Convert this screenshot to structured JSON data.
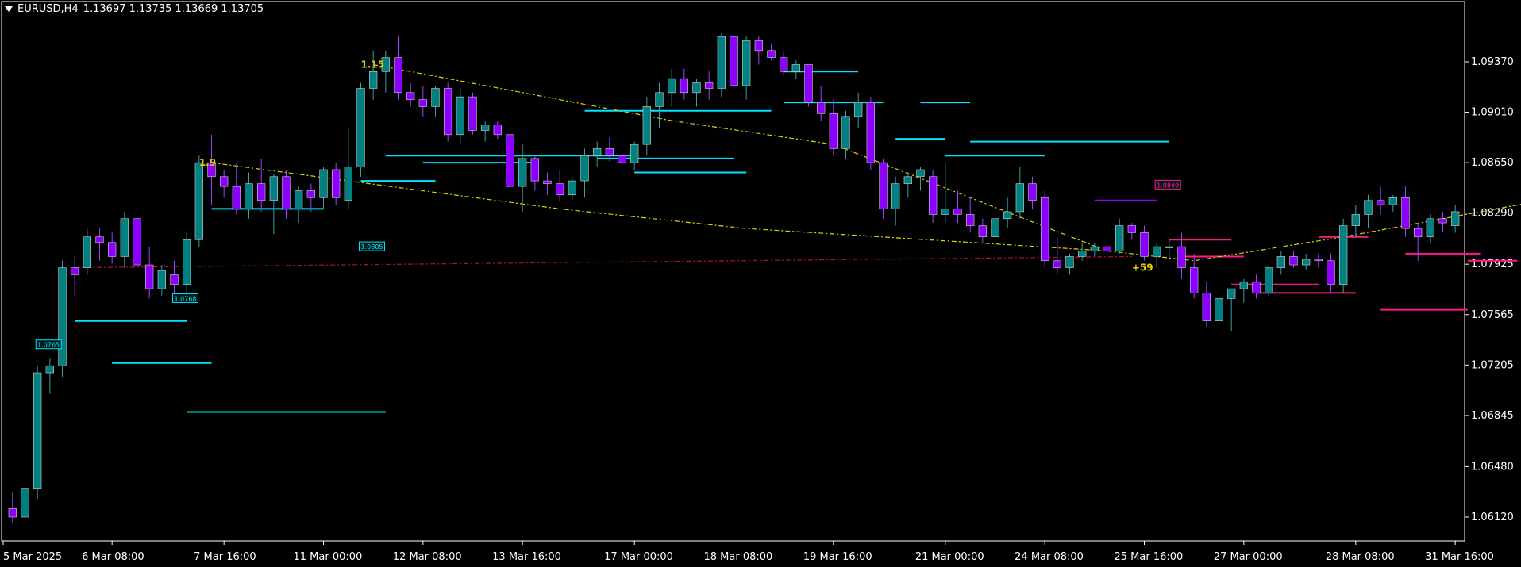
{
  "header": {
    "symbol": "EURUSD,H4",
    "ohlc": "1.13697 1.13735 1.13669 1.13705"
  },
  "colors": {
    "background": "#000000",
    "axis": "#ffffff",
    "bull": "#008080",
    "bear": "#8b00ff",
    "level_cyan": "#00e5ff",
    "level_magenta": "#ff1a8c",
    "trend_yellow": "#e0d000",
    "trend_red": "#b01030"
  },
  "chart_data": {
    "type": "candlestick",
    "ylim": [
      1.0595,
      1.098
    ],
    "y_ticks": [
      "1.09370",
      "1.09010",
      "1.08650",
      "1.08290",
      "1.07925",
      "1.07565",
      "1.07205",
      "1.06845",
      "1.06480",
      "1.06120"
    ],
    "x_ticks": [
      "5 Mar 2025",
      "6 Mar 08:00",
      "7 Mar 16:00",
      "11 Mar 00:00",
      "12 Mar 08:00",
      "13 Mar 16:00",
      "17 Mar 00:00",
      "18 Mar 08:00",
      "19 Mar 16:00",
      "21 Mar 00:00",
      "24 Mar 08:00",
      "25 Mar 16:00",
      "27 Mar 00:00",
      "28 Mar 08:00",
      "31 Mar 16:00"
    ],
    "candles": [
      [
        1.0618,
        1.063,
        1.0608,
        1.0612
      ],
      [
        1.0612,
        1.0634,
        1.0602,
        1.0632
      ],
      [
        1.0632,
        1.072,
        1.0625,
        1.0715
      ],
      [
        1.0715,
        1.0725,
        1.07,
        1.072
      ],
      [
        1.072,
        1.0795,
        1.0712,
        1.079
      ],
      [
        1.079,
        1.0798,
        1.077,
        1.0785
      ],
      [
        1.079,
        1.0818,
        1.0785,
        1.0812
      ],
      [
        1.0812,
        1.0818,
        1.0795,
        1.0808
      ],
      [
        1.0808,
        1.0815,
        1.0793,
        1.0798
      ],
      [
        1.0798,
        1.083,
        1.079,
        1.0825
      ],
      [
        1.0825,
        1.0845,
        1.0805,
        1.0792
      ],
      [
        1.0792,
        1.0805,
        1.0768,
        1.0775
      ],
      [
        1.0775,
        1.0792,
        1.077,
        1.0788
      ],
      [
        1.0785,
        1.0795,
        1.077,
        1.0778
      ],
      [
        1.0778,
        1.0815,
        1.0772,
        1.081
      ],
      [
        1.081,
        1.087,
        1.0805,
        1.0865
      ],
      [
        1.0865,
        1.0885,
        1.0835,
        1.0855
      ],
      [
        1.0855,
        1.086,
        1.084,
        1.0848
      ],
      [
        1.0848,
        1.0865,
        1.0828,
        1.0832
      ],
      [
        1.0832,
        1.0858,
        1.0825,
        1.085
      ],
      [
        1.085,
        1.0868,
        1.083,
        1.0838
      ],
      [
        1.0838,
        1.0857,
        1.0814,
        1.0855
      ],
      [
        1.0855,
        1.086,
        1.0825,
        1.0832
      ],
      [
        1.0832,
        1.0848,
        1.0822,
        1.0845
      ],
      [
        1.0845,
        1.085,
        1.083,
        1.084
      ],
      [
        1.084,
        1.0862,
        1.0832,
        1.086
      ],
      [
        1.086,
        1.0865,
        1.0835,
        1.084
      ],
      [
        1.0838,
        1.089,
        1.0832,
        1.0862
      ],
      [
        1.0862,
        1.0922,
        1.0855,
        1.0918
      ],
      [
        1.0918,
        1.0945,
        1.091,
        1.093
      ],
      [
        1.093,
        1.0945,
        1.0915,
        1.094
      ],
      [
        1.094,
        1.0955,
        1.091,
        1.0915
      ],
      [
        1.0915,
        1.0922,
        1.0905,
        1.091
      ],
      [
        1.091,
        1.092,
        1.0898,
        1.0905
      ],
      [
        1.0905,
        1.092,
        1.0898,
        1.0918
      ],
      [
        1.0918,
        1.0922,
        1.088,
        1.0885
      ],
      [
        1.0885,
        1.0918,
        1.0878,
        1.0912
      ],
      [
        1.0912,
        1.0915,
        1.0885,
        1.0888
      ],
      [
        1.0888,
        1.0895,
        1.088,
        1.0892
      ],
      [
        1.0892,
        1.0895,
        1.0882,
        1.0885
      ],
      [
        1.0885,
        1.089,
        1.084,
        1.0848
      ],
      [
        1.0848,
        1.0878,
        1.083,
        1.0868
      ],
      [
        1.0868,
        1.087,
        1.0845,
        1.0852
      ],
      [
        1.0852,
        1.0858,
        1.0842,
        1.085
      ],
      [
        1.085,
        1.086,
        1.0838,
        1.0842
      ],
      [
        1.0842,
        1.0855,
        1.0838,
        1.0852
      ],
      [
        1.0852,
        1.0875,
        1.084,
        1.087
      ],
      [
        1.087,
        1.088,
        1.0862,
        1.0875
      ],
      [
        1.0875,
        1.0883,
        1.0866,
        1.087
      ],
      [
        1.087,
        1.088,
        1.0862,
        1.0865
      ],
      [
        1.0865,
        1.088,
        1.086,
        1.0878
      ],
      [
        1.0878,
        1.0912,
        1.087,
        1.0905
      ],
      [
        1.0905,
        1.0922,
        1.089,
        1.0915
      ],
      [
        1.0915,
        1.0932,
        1.0905,
        1.0925
      ],
      [
        1.0925,
        1.0932,
        1.091,
        1.0915
      ],
      [
        1.0915,
        1.0925,
        1.0905,
        1.0922
      ],
      [
        1.0922,
        1.093,
        1.091,
        1.0918
      ],
      [
        1.0918,
        1.0958,
        1.0912,
        1.0955
      ],
      [
        1.0955,
        1.0958,
        1.0915,
        1.092
      ],
      [
        1.092,
        1.0955,
        1.091,
        1.0952
      ],
      [
        1.0952,
        1.0955,
        1.0935,
        1.0945
      ],
      [
        1.0945,
        1.095,
        1.0938,
        1.094
      ],
      [
        1.094,
        1.0945,
        1.0928,
        1.093
      ],
      [
        1.093,
        1.0938,
        1.0925,
        1.0935
      ],
      [
        1.0935,
        1.0935,
        1.0905,
        1.0908
      ],
      [
        1.0908,
        1.092,
        1.0895,
        1.09
      ],
      [
        1.09,
        1.091,
        1.087,
        1.0875
      ],
      [
        1.0875,
        1.0902,
        1.0868,
        1.0898
      ],
      [
        1.0898,
        1.0915,
        1.089,
        1.0908
      ],
      [
        1.0908,
        1.0912,
        1.086,
        1.0865
      ],
      [
        1.0865,
        1.0868,
        1.0825,
        1.0832
      ],
      [
        1.0832,
        1.0855,
        1.082,
        1.085
      ],
      [
        1.085,
        1.0858,
        1.084,
        1.0855
      ],
      [
        1.0855,
        1.0862,
        1.0845,
        1.086
      ],
      [
        1.0855,
        1.086,
        1.0822,
        1.0828
      ],
      [
        1.0828,
        1.0865,
        1.0822,
        1.0832
      ],
      [
        1.0832,
        1.0845,
        1.0822,
        1.0828
      ],
      [
        1.0828,
        1.084,
        1.0815,
        1.082
      ],
      [
        1.082,
        1.0825,
        1.0808,
        1.0812
      ],
      [
        1.0812,
        1.0848,
        1.0808,
        1.0825
      ],
      [
        1.0825,
        1.084,
        1.0818,
        1.083
      ],
      [
        1.083,
        1.0862,
        1.0825,
        1.085
      ],
      [
        1.085,
        1.0855,
        1.0832,
        1.0838
      ],
      [
        1.084,
        1.0845,
        1.079,
        1.0795
      ],
      [
        1.0795,
        1.0812,
        1.0785,
        1.079
      ],
      [
        1.079,
        1.08,
        1.0785,
        1.0798
      ],
      [
        1.0798,
        1.0808,
        1.0795,
        1.0802
      ],
      [
        1.0802,
        1.0808,
        1.0798,
        1.0805
      ],
      [
        1.0805,
        1.0808,
        1.0785,
        1.0802
      ],
      [
        1.0802,
        1.0825,
        1.08,
        1.082
      ],
      [
        1.082,
        1.0822,
        1.081,
        1.0815
      ],
      [
        1.0815,
        1.082,
        1.0795,
        1.0798
      ],
      [
        1.0798,
        1.0808,
        1.079,
        1.0805
      ],
      [
        1.0805,
        1.081,
        1.0795,
        1.0805
      ],
      [
        1.0805,
        1.0815,
        1.0782,
        1.079
      ],
      [
        1.079,
        1.08,
        1.0768,
        1.0772
      ],
      [
        1.0772,
        1.078,
        1.0748,
        1.0752
      ],
      [
        1.0752,
        1.0772,
        1.0748,
        1.0768
      ],
      [
        1.0768,
        1.0772,
        1.0745,
        1.0775
      ],
      [
        1.0775,
        1.0782,
        1.0765,
        1.078
      ],
      [
        1.078,
        1.0785,
        1.0768,
        1.0772
      ],
      [
        1.0772,
        1.0792,
        1.077,
        1.079
      ],
      [
        1.079,
        1.0802,
        1.0785,
        1.0798
      ],
      [
        1.0798,
        1.0802,
        1.079,
        1.0792
      ],
      [
        1.0792,
        1.08,
        1.0788,
        1.0796
      ],
      [
        1.0796,
        1.08,
        1.079,
        1.0795
      ],
      [
        1.0795,
        1.08,
        1.0772,
        1.0778
      ],
      [
        1.0778,
        1.0825,
        1.0772,
        1.082
      ],
      [
        1.082,
        1.0835,
        1.0812,
        1.0828
      ],
      [
        1.0828,
        1.0842,
        1.0818,
        1.0838
      ],
      [
        1.0838,
        1.0848,
        1.0828,
        1.0835
      ],
      [
        1.0835,
        1.0842,
        1.083,
        1.084
      ],
      [
        1.084,
        1.0848,
        1.0812,
        1.0818
      ],
      [
        1.0818,
        1.0822,
        1.0795,
        1.0812
      ],
      [
        1.0812,
        1.0828,
        1.0808,
        1.0825
      ],
      [
        1.0825,
        1.083,
        1.0815,
        1.0822
      ],
      [
        1.082,
        1.0835,
        1.0815,
        1.083
      ]
    ],
    "trend_lines": [
      {
        "color": "yellow",
        "points": [
          [
            29,
            1.0935
          ],
          [
            53,
            1.0895
          ],
          [
            66,
            1.0878
          ],
          [
            88,
            1.0802
          ]
        ]
      },
      {
        "color": "yellow",
        "points": [
          [
            16,
            1.0865
          ],
          [
            27,
            1.0852
          ],
          [
            44,
            1.0832
          ],
          [
            59,
            1.0818
          ],
          [
            88,
            1.0802
          ]
        ]
      },
      {
        "color": "yellow",
        "points": [
          [
            88,
            1.0802
          ],
          [
            95,
            1.0795
          ],
          [
            107,
            1.0812
          ],
          [
            123,
            1.0838
          ]
        ]
      },
      {
        "color": "red",
        "points": [
          [
            5,
            1.079
          ],
          [
            90,
            1.0798
          ]
        ]
      }
    ],
    "levels": [
      {
        "color": "cyan",
        "y": 1.0752,
        "x0": 5,
        "x1": 14
      },
      {
        "color": "cyan",
        "y": 1.0722,
        "x0": 8,
        "x1": 16
      },
      {
        "color": "cyan",
        "y": 1.0687,
        "x0": 14,
        "x1": 30
      },
      {
        "color": "cyan",
        "y": 1.0832,
        "x0": 16,
        "x1": 25
      },
      {
        "color": "cyan",
        "y": 1.087,
        "x0": 30,
        "x1": 50
      },
      {
        "color": "cyan",
        "y": 1.0865,
        "x0": 33,
        "x1": 42
      },
      {
        "color": "cyan",
        "y": 1.0852,
        "x0": 28,
        "x1": 34
      },
      {
        "color": "cyan",
        "y": 1.0902,
        "x0": 46,
        "x1": 61
      },
      {
        "color": "cyan",
        "y": 1.0868,
        "x0": 47,
        "x1": 58
      },
      {
        "color": "cyan",
        "y": 1.0858,
        "x0": 50,
        "x1": 59
      },
      {
        "color": "cyan",
        "y": 1.093,
        "x0": 62,
        "x1": 68
      },
      {
        "color": "cyan",
        "y": 1.0908,
        "x0": 62,
        "x1": 70
      },
      {
        "color": "cyan",
        "y": 1.0908,
        "x0": 73,
        "x1": 77
      },
      {
        "color": "cyan",
        "y": 1.0882,
        "x0": 71,
        "x1": 75
      },
      {
        "color": "cyan",
        "y": 1.087,
        "x0": 75,
        "x1": 83
      },
      {
        "color": "cyan",
        "y": 1.088,
        "x0": 77,
        "x1": 93
      },
      {
        "color": "magenta",
        "y": 1.081,
        "x0": 93,
        "x1": 98
      },
      {
        "color": "magenta",
        "y": 1.0798,
        "x0": 94,
        "x1": 99
      },
      {
        "color": "magenta",
        "y": 1.0778,
        "x0": 98,
        "x1": 105
      },
      {
        "color": "magenta",
        "y": 1.0772,
        "x0": 100,
        "x1": 108
      },
      {
        "color": "magenta",
        "y": 1.0812,
        "x0": 105,
        "x1": 109
      },
      {
        "color": "magenta",
        "y": 1.08,
        "x0": 112,
        "x1": 118
      },
      {
        "color": "magenta",
        "y": 1.0795,
        "x0": 117,
        "x1": 121
      },
      {
        "color": "magenta",
        "y": 1.076,
        "x0": 110,
        "x1": 117
      },
      {
        "color": "violet",
        "y": 1.0838,
        "x0": 87,
        "x1": 92
      }
    ],
    "labels": [
      {
        "text": "1.0765",
        "x": 2,
        "y": 1.0735,
        "color": "cyan"
      },
      {
        "text": "1.0805",
        "x": 28,
        "y": 1.0805,
        "color": "cyan"
      },
      {
        "text": "1.0768",
        "x": 13,
        "y": 1.0768,
        "color": "cyan"
      },
      {
        "text": "1.0849",
        "x": 92,
        "y": 1.0849,
        "color": "magenta"
      },
      {
        "text": "1.15",
        "x": 28,
        "y": 1.0935,
        "color": "yellow",
        "bold": true
      },
      {
        "text": "1.9",
        "x": 15,
        "y": 1.0865,
        "color": "yellow",
        "bold": true
      },
      {
        "text": "+59",
        "x": 90,
        "y": 1.079,
        "color": "yellow",
        "bold": true
      }
    ]
  }
}
